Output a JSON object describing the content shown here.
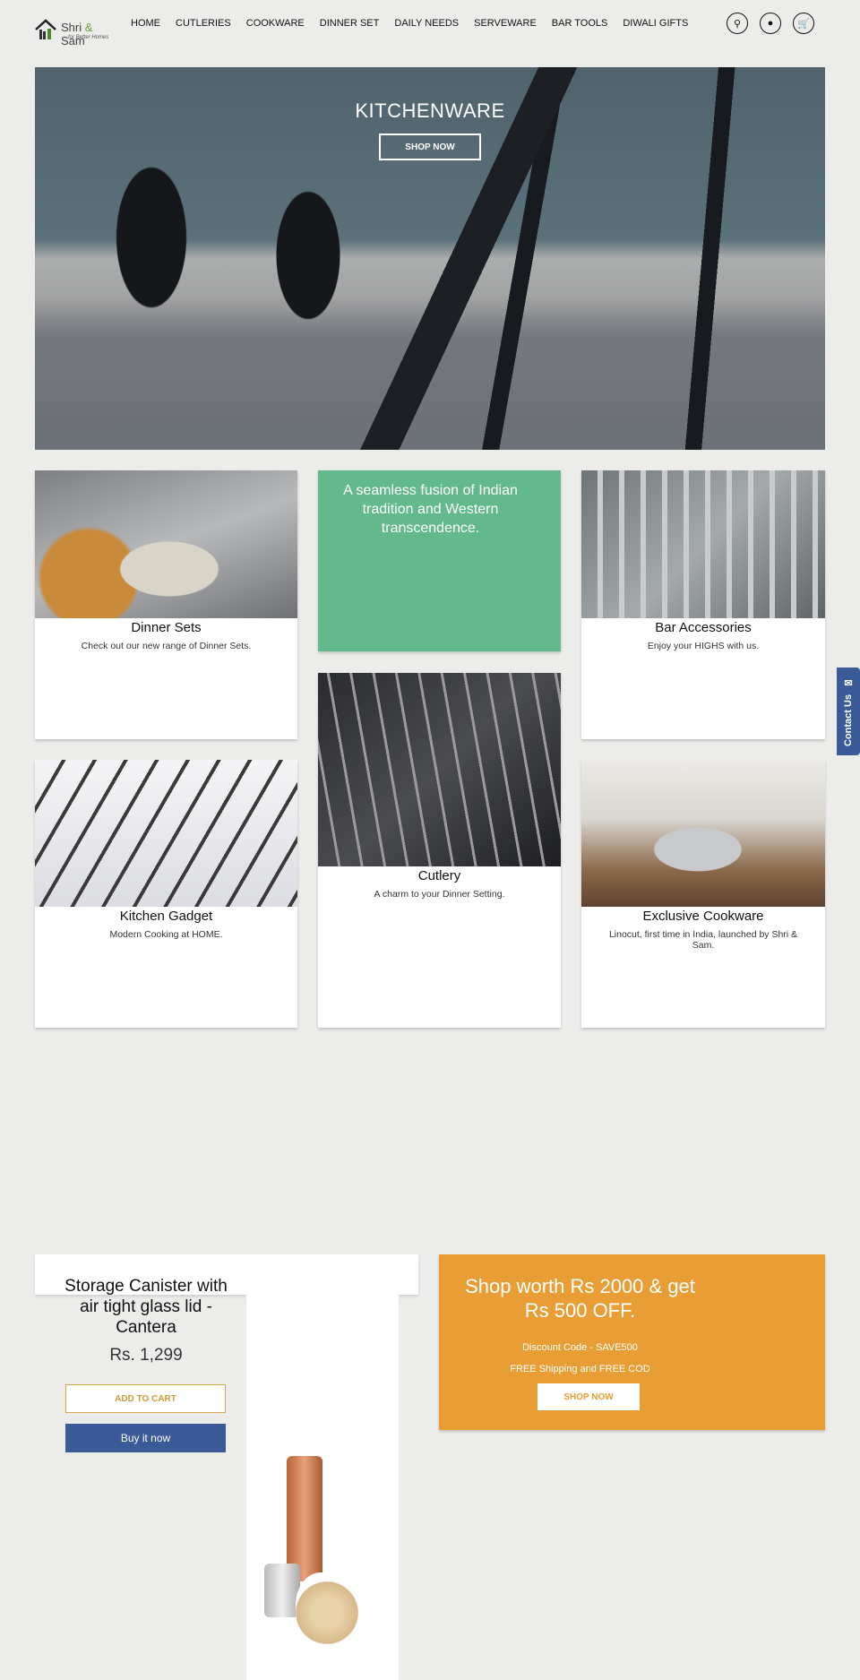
{
  "header": {
    "logo_name": "Shri",
    "logo_amp": " & ",
    "logo_name2": "Sam",
    "logo_tagline": "for Better Homes",
    "nav": [
      "HOME",
      "CUTLERIES",
      "COOKWARE",
      "DINNER SET",
      "DAILY NEEDS",
      "SERVEWARE",
      "BAR TOOLS",
      "DIWALI GIFTS"
    ],
    "icons": [
      "search-icon",
      "account-icon",
      "cart-icon"
    ]
  },
  "hero": {
    "title": "KITCHENWARE",
    "button": "SHOP NOW"
  },
  "collections": [
    {
      "title": "Dinner Sets",
      "desc": "Check out our new range of Dinner Sets."
    },
    {
      "title": "Bar Accessories",
      "desc": "Enjoy your HIGHS with us."
    },
    {
      "title": "Cutlery",
      "desc": "A charm to your Dinner Setting."
    },
    {
      "title": "Kitchen Gadget",
      "desc": "Modern Cooking at HOME."
    },
    {
      "title": "Exclusive Cookware",
      "desc": "Linocut, first time in India, launched by Shri & Sam."
    }
  ],
  "tagline": "A seamless fusion of Indian tradition and Western transcendence.",
  "contact_tab": "Contact Us",
  "product": {
    "title": "Storage Canister with air tight glass lid - Cantera",
    "price": "Rs. 1,299",
    "add_to_cart": "ADD TO CART",
    "buy_now": "Buy it now"
  },
  "promo": {
    "title": "Shop worth Rs 2000 & get Rs 500 OFF.",
    "code": "Discount Code - SAVE500",
    "shipping": "FREE Shipping and FREE COD",
    "button": "SHOP NOW"
  },
  "colors": {
    "green": "#62b98c",
    "orange": "#e99d35",
    "blue": "#3a5a98",
    "background": "#ececea"
  }
}
